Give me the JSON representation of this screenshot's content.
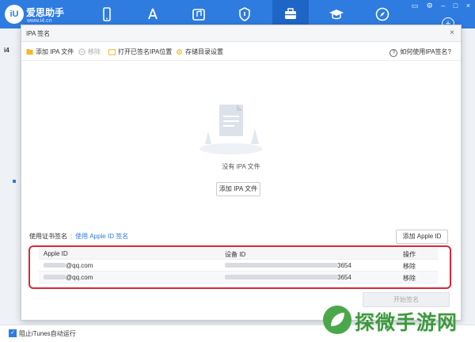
{
  "app": {
    "logo_text": "iU",
    "brand": "爱思助手",
    "brand_url": "www.i4.cn",
    "side_letter": "i4"
  },
  "nav": {
    "icons": [
      "phone-icon",
      "appstore-icon",
      "music-icon",
      "ringtone-icon",
      "toolbox-icon",
      "graduation-icon",
      "compass-icon"
    ],
    "active": "toolbox-icon",
    "window_buttons": [
      "▭",
      "⚙",
      "–",
      "□",
      "×"
    ]
  },
  "dialog": {
    "title": "IPA 签名",
    "close": "×",
    "toolbar": {
      "add_ipa": "添加 IPA 文件",
      "remove": "移除",
      "open_signed": "打开已签名IPA位置",
      "storage_settings": "存储目录设置",
      "help": "如何使用IPA签名?"
    },
    "empty_text": "没有 IPA 文件",
    "add_ipa_button": "添加 IPA 文件",
    "tabs": {
      "cert": "使用证书签名",
      "apple_id": "使用 Apple ID 签名"
    },
    "add_apple_id": "添加 Apple ID",
    "table": {
      "headers": {
        "apple_id": "Apple ID",
        "device_id": "设备 ID",
        "action": "操作"
      },
      "rows": [
        {
          "apple_id_suffix": "@qq.com",
          "device_suffix": "3654",
          "action": "移除"
        },
        {
          "apple_id_suffix": "@qq.com",
          "device_suffix": "3654",
          "action": "移除"
        }
      ]
    },
    "start_button": "开始签名"
  },
  "footer": {
    "checkbox_label": "阻止iTunes自动运行",
    "checked": true
  },
  "watermark": "探微手游网",
  "colors": {
    "accent": "#2e7ce0",
    "highlight": "#d9273a",
    "watermark": "#3c9a3c"
  }
}
